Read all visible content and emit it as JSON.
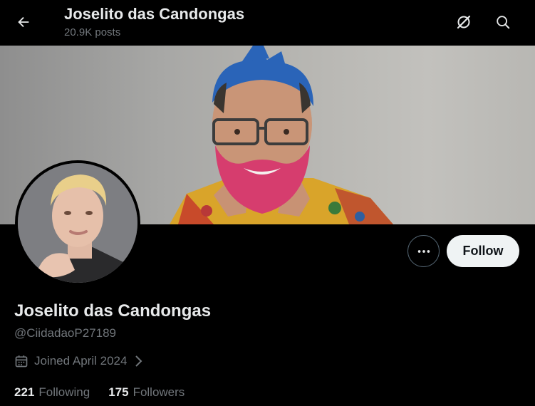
{
  "header": {
    "title": "Joselito das Candongas",
    "posts_count": "20.9K posts"
  },
  "icons": {
    "back": "arrow-left-icon",
    "grok": "grok-icon",
    "search": "search-icon",
    "more": "more-dots-icon",
    "calendar": "calendar-icon",
    "chevron": "chevron-right-icon"
  },
  "profile": {
    "display_name": "Joselito das Candongas",
    "handle": "@CiidadaoP27189",
    "joined": "Joined April 2024",
    "following_count": "221",
    "following_label": "Following",
    "followers_count": "175",
    "followers_label": "Followers"
  },
  "actions": {
    "follow_label": "Follow"
  },
  "colors": {
    "background": "#000000",
    "text_primary": "#e7e9ea",
    "text_secondary": "#71767b",
    "follow_bg": "#eff3f4",
    "follow_text": "#0f1419",
    "border": "#536471"
  }
}
